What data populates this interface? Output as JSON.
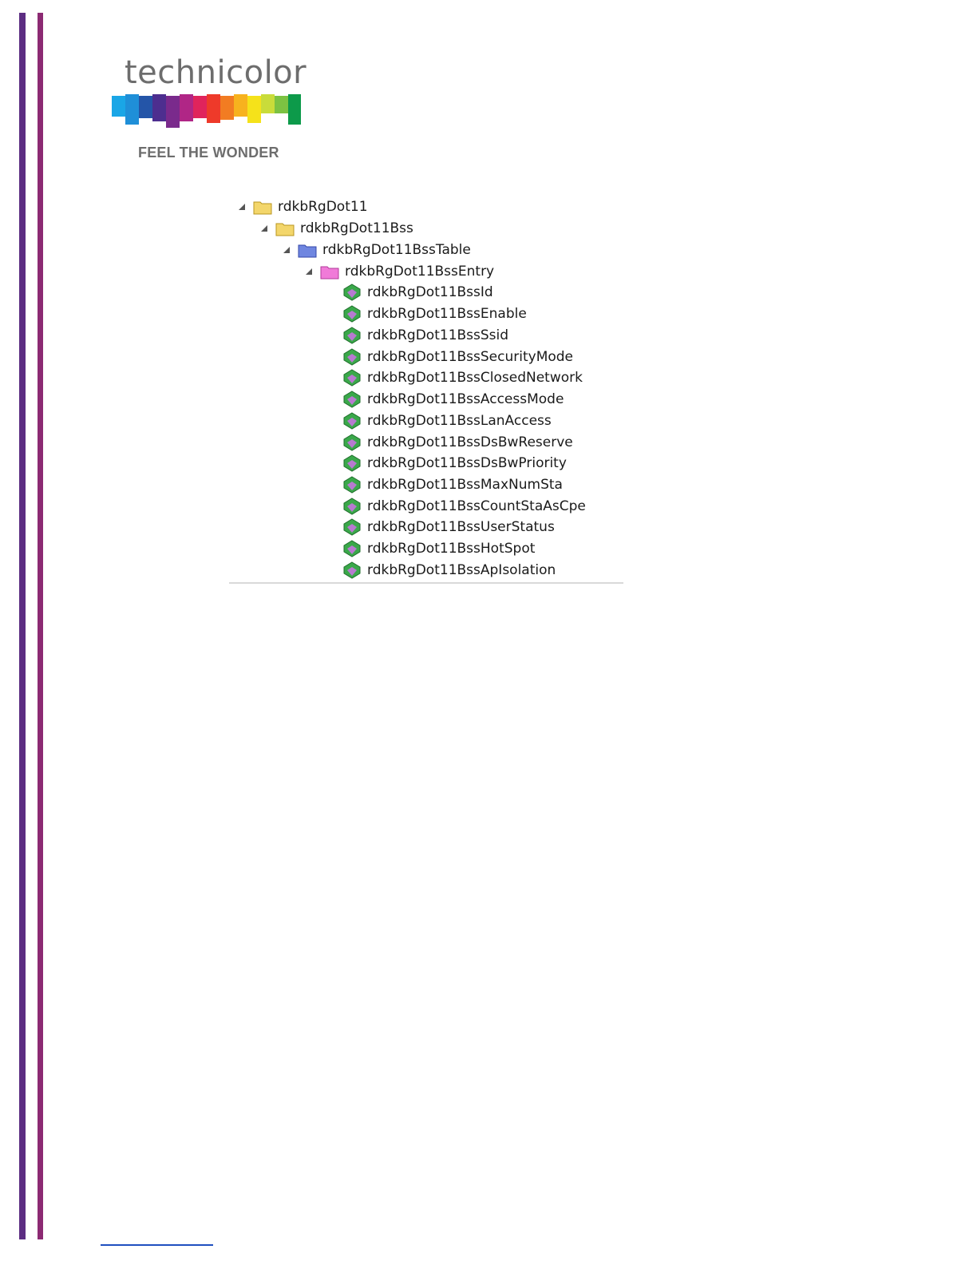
{
  "brand": {
    "wordmark": "technicolor",
    "tagline": "FEEL THE WONDER"
  },
  "tree": {
    "root": {
      "label": "rdkbRgDot11",
      "icon": "folder-yellow-icon",
      "expanded": true
    },
    "group": {
      "label": "rdkbRgDot11Bss",
      "icon": "folder-yellow-icon",
      "expanded": true
    },
    "table": {
      "label": "rdkbRgDot11BssTable",
      "icon": "folder-blue-icon",
      "expanded": true
    },
    "entry": {
      "label": "rdkbRgDot11BssEntry",
      "icon": "folder-pink-icon",
      "expanded": true
    },
    "leaves": [
      {
        "label": "rdkbRgDot11BssId"
      },
      {
        "label": "rdkbRgDot11BssEnable"
      },
      {
        "label": "rdkbRgDot11BssSsid"
      },
      {
        "label": "rdkbRgDot11BssSecurityMode"
      },
      {
        "label": "rdkbRgDot11BssClosedNetwork"
      },
      {
        "label": "rdkbRgDot11BssAccessMode"
      },
      {
        "label": "rdkbRgDot11BssLanAccess"
      },
      {
        "label": "rdkbRgDot11BssDsBwReserve"
      },
      {
        "label": "rdkbRgDot11BssDsBwPriority"
      },
      {
        "label": "rdkbRgDot11BssMaxNumSta"
      },
      {
        "label": "rdkbRgDot11BssCountStaAsCpe"
      },
      {
        "label": "rdkbRgDot11BssUserStatus"
      },
      {
        "label": "rdkbRgDot11BssHotSpot"
      },
      {
        "label": "rdkbRgDot11BssApIsolation"
      }
    ]
  },
  "colors": {
    "bar_left": "#5c2d82",
    "bar_right": "#8c2a73",
    "folder_yellow": "#f3d66b",
    "folder_blue": "#6f86e0",
    "folder_pink": "#f07ad8",
    "leaf_green": "#3aa84a",
    "leaf_purple": "#b77ad0"
  }
}
